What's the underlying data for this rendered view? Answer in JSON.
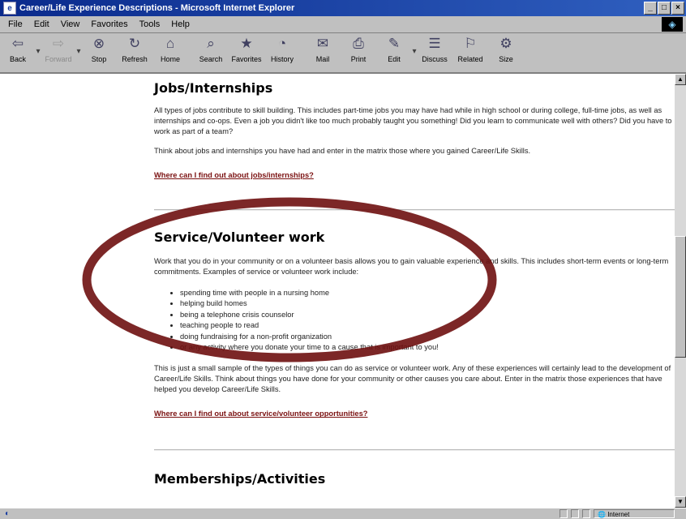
{
  "window": {
    "title": "Career/Life Experience Descriptions - Microsoft Internet Explorer"
  },
  "menu": [
    "File",
    "Edit",
    "View",
    "Favorites",
    "Tools",
    "Help"
  ],
  "toolbar": [
    {
      "label": "Back",
      "icon": "⇦"
    },
    {
      "label": "Forward",
      "icon": "⇨"
    },
    {
      "label": "Stop",
      "icon": "⊗"
    },
    {
      "label": "Refresh",
      "icon": "↻"
    },
    {
      "label": "Home",
      "icon": "⌂"
    },
    {
      "label": "Search",
      "icon": "⌕"
    },
    {
      "label": "Favorites",
      "icon": "★"
    },
    {
      "label": "History",
      "icon": "◔"
    },
    {
      "label": "Mail",
      "icon": "✉"
    },
    {
      "label": "Print",
      "icon": "⎙"
    },
    {
      "label": "Edit",
      "icon": "✎"
    },
    {
      "label": "Discuss",
      "icon": "☰"
    },
    {
      "label": "Related",
      "icon": "⚐"
    },
    {
      "label": "Size",
      "icon": "⚙"
    }
  ],
  "sections": {
    "jobs": {
      "heading": "Jobs/Internships",
      "p1": "All types of jobs contribute to skill building. This includes part-time jobs you may have had while in high school or during college, full-time jobs, as well as internships and co-ops. Even a job you didn't like too much probably taught you something! Did you learn to communicate well with others? Did you have to work as part of a team?",
      "p2": "Think about jobs and internships you have had and enter in the matrix those where you gained Career/Life Skills.",
      "link": "Where can I find out about jobs/internships?"
    },
    "service": {
      "heading": "Service/Volunteer work",
      "p1": "Work that you do in your community or on a volunteer basis allows you to gain valuable experience and skills. This includes short-term events or long-term commitments. Examples of service or volunteer work include:",
      "items": [
        "spending time with people in a nursing home",
        "helping build homes",
        "being a telephone crisis counselor",
        "teaching people to read",
        "doing fundraising for a non-profit organization",
        "or any activity where you donate your time to a cause that is important to you!"
      ],
      "p2": "This is just a small sample of the types of things you can do as service or volunteer work. Any of these experiences will certainly lead to the development of Career/Life Skills. Think about things you have done for your community or other causes you care about. Enter in the matrix those experiences that have helped you develop Career/Life Skills.",
      "link": "Where can I find out about service/volunteer opportunities?"
    },
    "memberships": {
      "heading": "Memberships/Activities"
    }
  },
  "status": {
    "zone": "Internet"
  },
  "colors": {
    "highlight_ellipse": "#6e0f0f",
    "link": "#7a1010",
    "titlebar": "#0a2a8c"
  }
}
